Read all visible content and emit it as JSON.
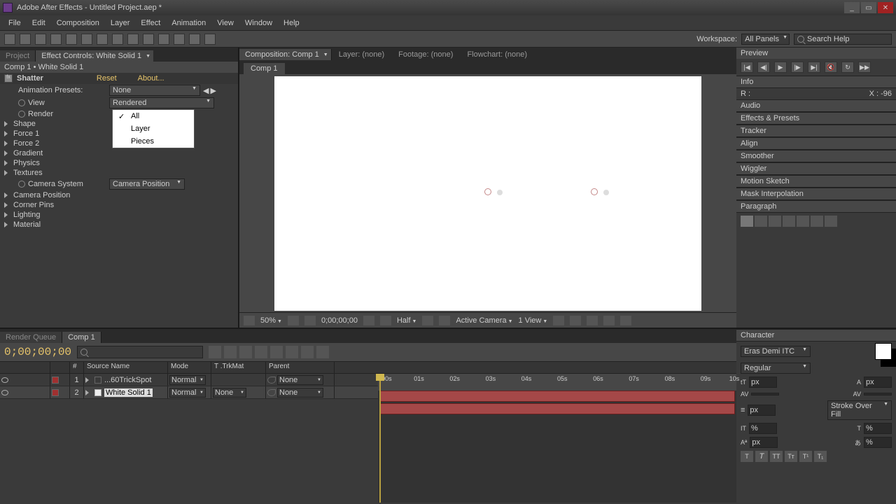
{
  "title": "Adobe After Effects - Untitled Project.aep *",
  "menubar": [
    "File",
    "Edit",
    "Composition",
    "Layer",
    "Effect",
    "Animation",
    "View",
    "Window",
    "Help"
  ],
  "toolbar": {
    "workspace_label": "Workspace: ",
    "workspace_value": "All Panels",
    "search_placeholder": "Search Help"
  },
  "left_panel": {
    "project_tab": "Project",
    "effect_tab": "Effect Controls: White Solid 1",
    "breadcrumb": "Comp 1 • White Solid 1",
    "effect_name": "Shatter",
    "reset": "Reset",
    "about": "About...",
    "presets_label": "Animation Presets:",
    "presets_value": "None",
    "props": {
      "view": "View",
      "render": "Render",
      "shape": "Shape",
      "force1": "Force 1",
      "force2": "Force 2",
      "gradient": "Gradient",
      "physics": "Physics",
      "textures": "Textures",
      "camera_system": "Camera System",
      "camera_position": "Camera Position",
      "corner_pins": "Corner Pins",
      "lighting": "Lighting",
      "material": "Material"
    },
    "view_value": "Rendered",
    "camera_value": "Camera Position",
    "dropdown": {
      "all": "All",
      "layer": "Layer",
      "pieces": "Pieces"
    }
  },
  "center_tabs": {
    "composition": "Composition: Comp 1",
    "layer": "Layer: (none)",
    "footage": "Footage: (none)",
    "flowchart": "Flowchart: (none)",
    "subtab": "Comp 1"
  },
  "viewer_footer": {
    "zoom": "50%",
    "time": "0;00;00;00",
    "res": "Half",
    "camera": "Active Camera",
    "views": "1 View"
  },
  "right": {
    "preview": "Preview",
    "info": "Info",
    "info_r": "R :",
    "info_x": "X : -96",
    "audio": "Audio",
    "effects_presets": "Effects & Presets",
    "tracker": "Tracker",
    "align": "Align",
    "smoother": "Smoother",
    "wiggler": "Wiggler",
    "motion_sketch": "Motion Sketch",
    "mask_interp": "Mask Interpolation",
    "paragraph": "Paragraph",
    "character": "Character",
    "font": "Eras Demi ITC",
    "font_style": "Regular",
    "stroke_fill": "Stroke Over Fill",
    "tt_btn": "TT",
    "px": "px"
  },
  "timeline": {
    "render_queue": "Render Queue",
    "comp_tab": "Comp 1",
    "timecode": "0;00;00;00",
    "headers": {
      "source": "Source Name",
      "mode": "Mode",
      "trkmat": "T  .TrkMat",
      "parent": "Parent"
    },
    "layers": [
      {
        "num": "1",
        "name": "...60TrickSpot",
        "mode": "Normal",
        "trk": "",
        "parent": "None"
      },
      {
        "num": "2",
        "name": "White Solid 1",
        "mode": "Normal",
        "trk": "None",
        "parent": "None"
      }
    ],
    "ticks": [
      "00s",
      "01s",
      "02s",
      "03s",
      "04s",
      "05s",
      "06s",
      "07s",
      "08s",
      "09s",
      "10s"
    ]
  }
}
